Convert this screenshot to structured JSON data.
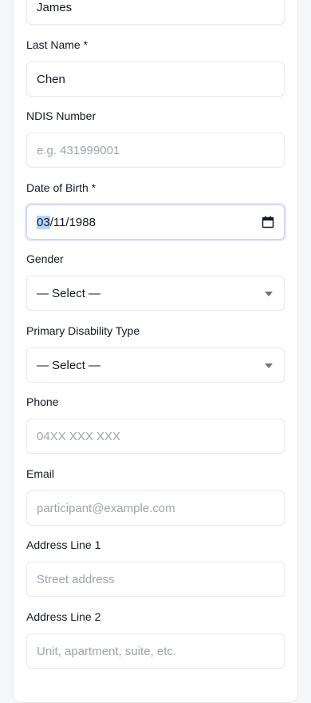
{
  "form": {
    "first_name": {
      "value": "James"
    },
    "last_name": {
      "label": "Last Name *",
      "value": "Chen"
    },
    "ndis_number": {
      "label": "NDIS Number",
      "placeholder": "e.g. 431999001"
    },
    "date_of_birth": {
      "label": "Date of Birth *",
      "day": "03",
      "rest": "/11/1988"
    },
    "gender": {
      "label": "Gender",
      "selected": "— Select —"
    },
    "primary_disability": {
      "label": "Primary Disability Type",
      "selected": "— Select —"
    },
    "phone": {
      "label": "Phone",
      "placeholder": "04XX XXX XXX"
    },
    "email": {
      "label": "Email",
      "placeholder": "participant@example.com"
    },
    "address_line_1": {
      "label": "Address Line 1",
      "placeholder": "Street address"
    },
    "address_line_2": {
      "label": "Address Line 2",
      "placeholder": "Unit, apartment, suite, etc."
    }
  },
  "icons": {
    "calendar": "calendar-icon",
    "dropdown": "chevron-down-icon"
  }
}
